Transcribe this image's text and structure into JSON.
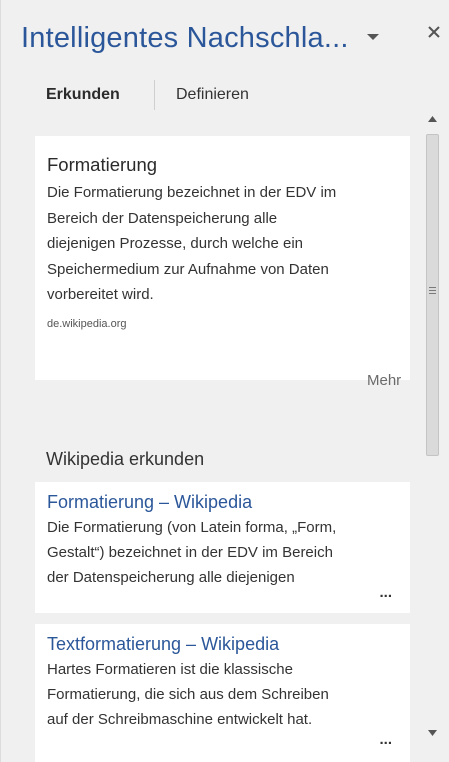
{
  "pane": {
    "title": "Intelligentes Nachschla...",
    "dropdown_icon": "chevron-down-icon",
    "close_icon": "close-icon"
  },
  "tabs": [
    {
      "label": "Erkunden",
      "active": true
    },
    {
      "label": "Definieren",
      "active": false
    }
  ],
  "definition_card": {
    "title": "Formatierung",
    "lines": [
      "Die Formatierung bezeichnet in der EDV im",
      "Bereich der Datenspeicherung alle",
      "diejenigen Prozesse, durch welche ein",
      "Speichermedium zur Aufnahme von Daten",
      "vorbereitet wird."
    ],
    "source": "de.wikipedia.org"
  },
  "more_label": "Mehr",
  "wiki_section": {
    "heading": "Wikipedia erkunden",
    "results": [
      {
        "title": "Formatierung – Wikipedia",
        "lines": [
          "Die Formatierung (von Latein forma, „Form,",
          "Gestalt“) bezeichnet in der EDV im Bereich",
          "der Datenspeicherung alle diejenigen"
        ],
        "ellipsis": "..."
      },
      {
        "title": "Textformatierung – Wikipedia",
        "lines": [
          "Hartes Formatieren ist die klassische",
          "Formatierung, die sich aus dem Schreiben",
          "auf der Schreibmaschine entwickelt hat."
        ],
        "ellipsis": "..."
      }
    ]
  },
  "colors": {
    "accent": "#2b579a",
    "pane_bg": "#f0f0f0",
    "card_bg": "#ffffff"
  }
}
